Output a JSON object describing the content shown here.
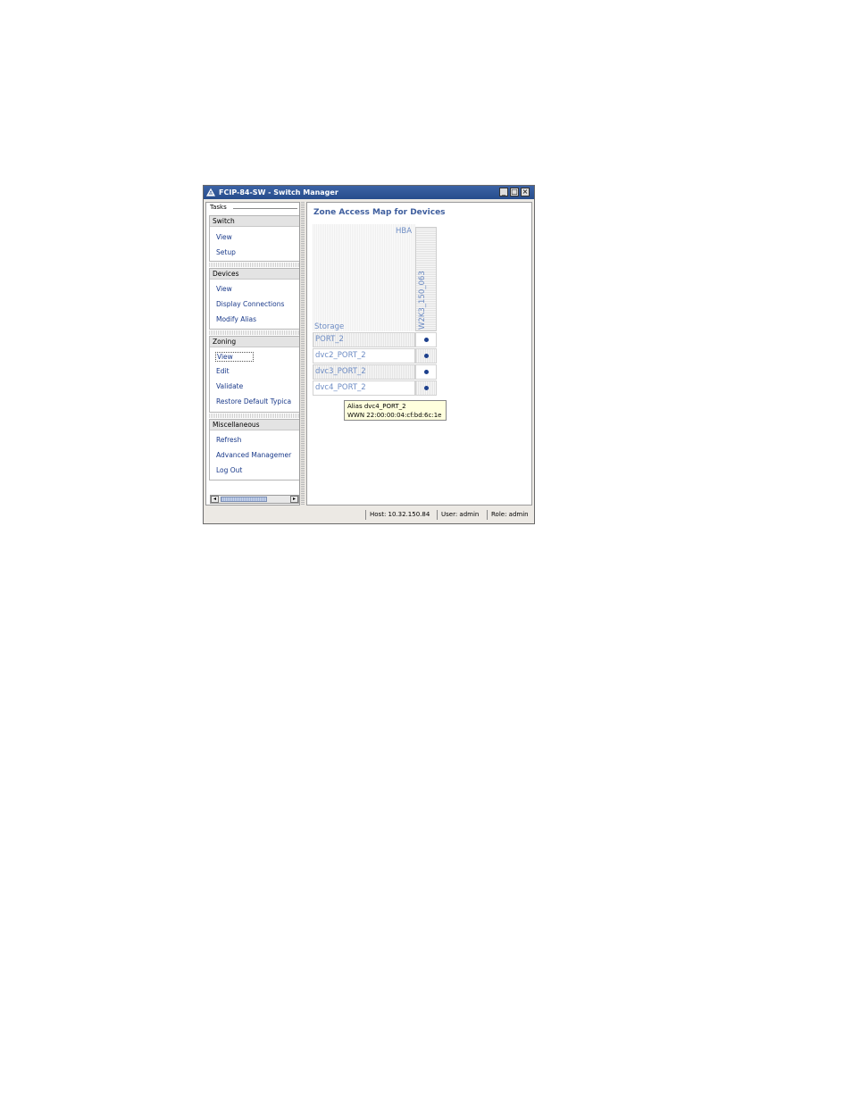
{
  "window": {
    "title": "FCIP-84-SW - Switch Manager",
    "controls": {
      "minimize": "_",
      "maximize": "□",
      "close": "×"
    }
  },
  "sidebar": {
    "heading": "Tasks",
    "groups": [
      {
        "label": "Switch",
        "items": [
          "View",
          "Setup"
        ]
      },
      {
        "label": "Devices",
        "items": [
          "View",
          "Display Connections",
          "Modify Alias"
        ]
      },
      {
        "label": "Zoning",
        "items": [
          "View",
          "Edit",
          "Validate",
          "Restore Default Typica"
        ],
        "selected_index": 0
      },
      {
        "label": "Miscellaneous",
        "items": [
          "Refresh",
          "Advanced Managemer",
          "Log Out"
        ]
      }
    ]
  },
  "content": {
    "title": "Zone Access Map for Devices",
    "hba_label": "HBA",
    "storage_label": "Storage",
    "column": "W2K3_150_063",
    "rows": [
      {
        "label": "PORT_2",
        "access": true
      },
      {
        "label": "dvc2_PORT_2",
        "access": true
      },
      {
        "label": "dvc3_PORT_2",
        "access": true
      },
      {
        "label": "dvc4_PORT_2",
        "access": true
      }
    ],
    "tooltip": {
      "line1": "Alias  dvc4_PORT_2",
      "line2": "WWN  22:00:00:04:cf:bd:6c:1e"
    }
  },
  "statusbar": {
    "host": "Host: 10.32.150.84",
    "user": "User: admin",
    "role": "Role: admin"
  },
  "colors": {
    "titlebar": "#2f5899",
    "link": "#1a3a8a",
    "map_label": "#6d8cc4",
    "dot": "#1c3f8c",
    "tooltip_bg": "#ffffdd"
  }
}
